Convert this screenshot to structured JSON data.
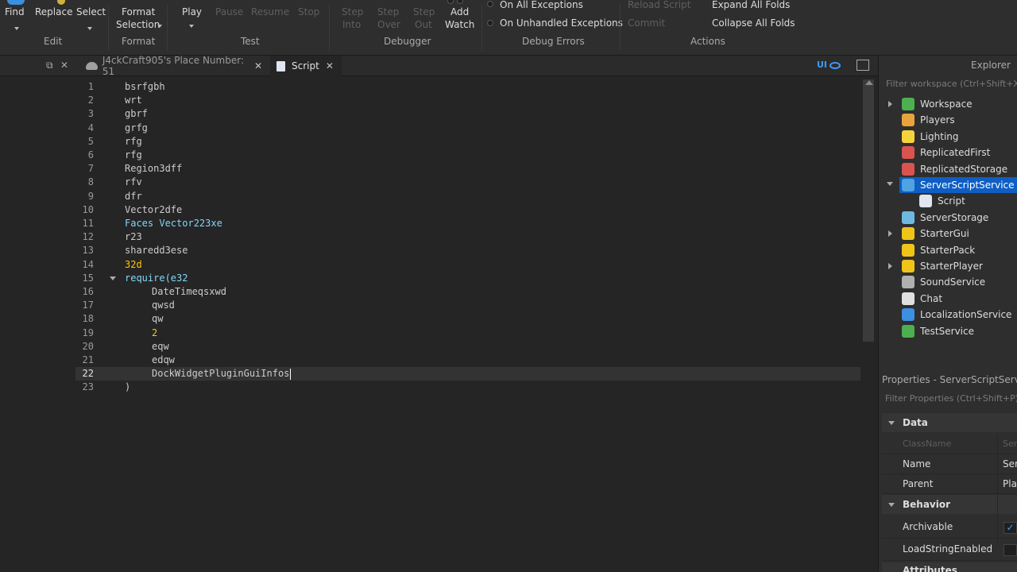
{
  "ribbon": {
    "find": "Find",
    "replace": "Replace",
    "select": "Select",
    "edit_group": "Edit",
    "format_selection_1": "Format",
    "format_selection_2": "Selection",
    "format_group": "Format",
    "play": "Play",
    "pause": "Pause",
    "resume": "Resume",
    "stop": "Stop",
    "test_group": "Test",
    "step_into_1": "Step",
    "step_into_2": "Into",
    "step_over_1": "Step",
    "step_over_2": "Over",
    "step_out_1": "Step",
    "step_out_2": "Out",
    "add_watch_1": "Add",
    "add_watch_2": "Watch",
    "debugger_group": "Debugger",
    "on_all_exceptions": "On All Exceptions",
    "on_unhandled_exceptions": "On Unhandled Exceptions",
    "debug_errors_group": "Debug Errors",
    "reload_script": "Reload Script",
    "commit": "Commit",
    "expand_all_folds": "Expand All Folds",
    "collapse_all_folds": "Collapse All Folds",
    "actions_group": "Actions"
  },
  "tabs": [
    {
      "label": "J4ckCraft905's Place Number: 51",
      "close": "✕"
    },
    {
      "label": "Script",
      "close": "✕"
    }
  ],
  "left_close": "✕",
  "editor": {
    "current_line": 22,
    "lines": [
      {
        "n": "1",
        "text": "bsrfgbh"
      },
      {
        "n": "2",
        "text": "wrt"
      },
      {
        "n": "3",
        "text": "gbrf"
      },
      {
        "n": "4",
        "text": "grfg"
      },
      {
        "n": "5",
        "text": "rfg"
      },
      {
        "n": "6",
        "text": "rfg"
      },
      {
        "n": "7",
        "text": "Region3dff"
      },
      {
        "n": "8",
        "text": "rfv"
      },
      {
        "n": "9",
        "text": "dfr"
      },
      {
        "n": "10",
        "text": "Vector2dfe"
      },
      {
        "n": "11",
        "text": "Faces Vector223xe"
      },
      {
        "n": "12",
        "text": "r23"
      },
      {
        "n": "13",
        "text": "sharedd3ese"
      },
      {
        "n": "14",
        "text": "32d"
      },
      {
        "n": "15",
        "text": "require(e32"
      },
      {
        "n": "16",
        "text": "DateTimeqsxwd"
      },
      {
        "n": "17",
        "text": "qwsd"
      },
      {
        "n": "18",
        "text": "qw"
      },
      {
        "n": "19",
        "text": "2"
      },
      {
        "n": "20",
        "text": "eqw"
      },
      {
        "n": "21",
        "text": "edqw"
      },
      {
        "n": "22",
        "text": "DockWidgetPluginGuiInfos"
      },
      {
        "n": "23",
        "text": ")"
      }
    ]
  },
  "explorer": {
    "title": "Explorer",
    "filter_placeholder": "Filter workspace (Ctrl+Shift+X)",
    "items": [
      {
        "label": "Workspace",
        "icon": "globe-icon",
        "color": "#4caf50"
      },
      {
        "label": "Players",
        "icon": "players-icon",
        "color": "#e8a33d"
      },
      {
        "label": "Lighting",
        "icon": "lightbulb-icon",
        "color": "#f5d33b"
      },
      {
        "label": "ReplicatedFirst",
        "icon": "replicated-first-icon",
        "color": "#d9534f"
      },
      {
        "label": "ReplicatedStorage",
        "icon": "replicated-storage-icon",
        "color": "#d9534f"
      },
      {
        "label": "ServerScriptService",
        "icon": "server-script-service-icon",
        "color": "#4fa3e0"
      },
      {
        "label": "Script",
        "icon": "script-icon",
        "color": "#dfe6ef"
      },
      {
        "label": "ServerStorage",
        "icon": "server-storage-icon",
        "color": "#6fb9e0"
      },
      {
        "label": "StarterGui",
        "icon": "starter-gui-icon",
        "color": "#f0c419"
      },
      {
        "label": "StarterPack",
        "icon": "starter-pack-icon",
        "color": "#f0c419"
      },
      {
        "label": "StarterPlayer",
        "icon": "starter-player-icon",
        "color": "#f0c419"
      },
      {
        "label": "SoundService",
        "icon": "sound-service-icon",
        "color": "#b0b0b0"
      },
      {
        "label": "Chat",
        "icon": "chat-icon",
        "color": "#e0e0e0"
      },
      {
        "label": "LocalizationService",
        "icon": "localization-icon",
        "color": "#3d8fe0"
      },
      {
        "label": "TestService",
        "icon": "test-service-icon",
        "color": "#4caf50"
      }
    ]
  },
  "properties": {
    "title": "Properties - ServerScriptService",
    "filter_placeholder": "Filter Properties (Ctrl+Shift+P)",
    "data_section": "Data",
    "classname_key": "ClassName",
    "classname_val": "Ser",
    "name_key": "Name",
    "name_val": "Ser",
    "parent_key": "Parent",
    "parent_val": "Pla",
    "behavior_section": "Behavior",
    "archivable_key": "Archivable",
    "archivable_check": "✓",
    "loadstring_key": "LoadStringEnabled",
    "attributes_section": "Attributes"
  },
  "colors": {
    "accent": "#0e5ec4",
    "background": "#252525",
    "keyword_blue": "#84d6f7",
    "number_yellow": "#ffc600"
  }
}
